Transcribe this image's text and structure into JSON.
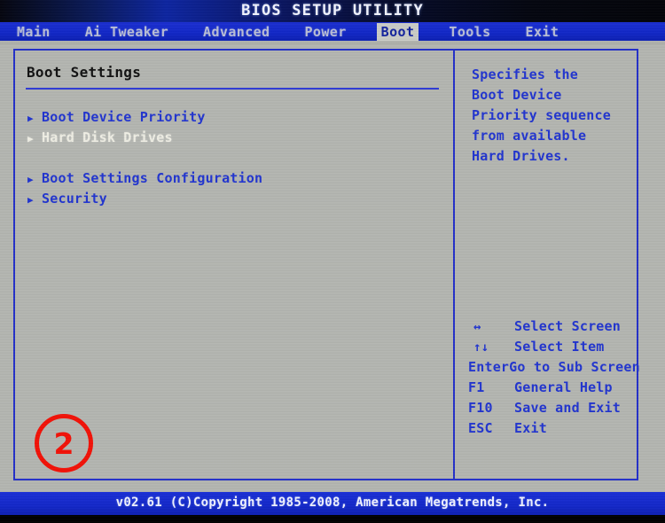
{
  "window": {
    "title": "BIOS SETUP UTILITY"
  },
  "menubar": {
    "tabs": [
      {
        "label": "Main",
        "active": false
      },
      {
        "label": "Ai Tweaker",
        "active": false
      },
      {
        "label": "Advanced",
        "active": false
      },
      {
        "label": "Power",
        "active": false
      },
      {
        "label": "Boot",
        "active": true
      },
      {
        "label": "Tools",
        "active": false
      },
      {
        "label": "Exit",
        "active": false
      }
    ]
  },
  "left_panel": {
    "heading": "Boot Settings",
    "items": [
      {
        "caret": "▶",
        "label": "Boot Device Priority",
        "selected": false
      },
      {
        "caret": "▶",
        "label": "Hard Disk Drives",
        "selected": true
      },
      {
        "caret": "▶",
        "label": "Boot Settings Configuration",
        "selected": false
      },
      {
        "caret": "▶",
        "label": "Security",
        "selected": false
      }
    ]
  },
  "right_panel": {
    "help_lines": [
      "Specifies the",
      "Boot Device",
      "Priority sequence",
      "from available",
      "Hard Drives."
    ],
    "key_legend": [
      {
        "key": "↔",
        "desc": "Select Screen",
        "glyph": true
      },
      {
        "key": "↑↓",
        "desc": "Select Item",
        "glyph": true
      },
      {
        "key": "Enter",
        "desc": "Go to Sub Screen",
        "glyph": false
      },
      {
        "key": "F1",
        "desc": "General Help",
        "glyph": false
      },
      {
        "key": "F10",
        "desc": "Save and Exit",
        "glyph": false
      },
      {
        "key": "ESC",
        "desc": "Exit",
        "glyph": false
      }
    ]
  },
  "footer": {
    "text": "v02.61 (C)Copyright 1985-2008, American Megatrends, Inc."
  },
  "annotation": {
    "number": "2",
    "color": "#f21208"
  },
  "colors": {
    "menubar_blue": "#1127c6",
    "panel_gray": "#b4b6b1",
    "text_blue": "#2235cf",
    "selected_text": "#efeee4",
    "heading_black": "#121212",
    "footer_blue": "#1328c9"
  }
}
